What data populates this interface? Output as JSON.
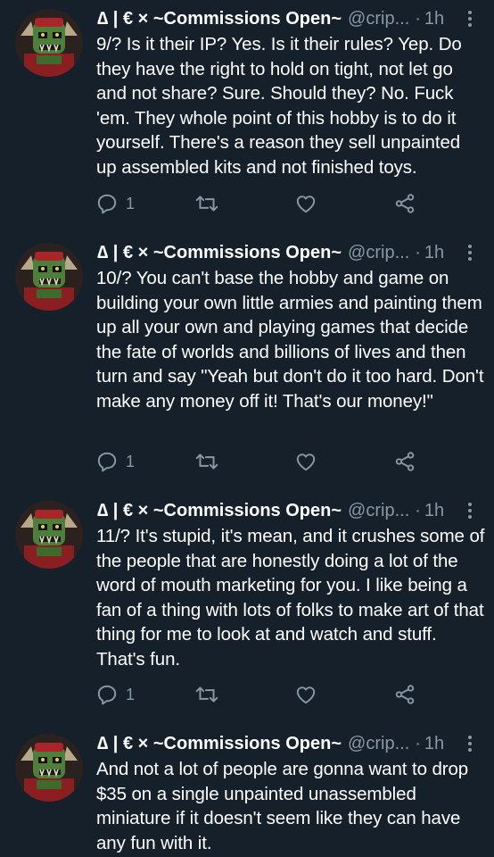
{
  "tweets": [
    {
      "display_name": "∆ | € × ~Commissions Open~",
      "handle": "@crip...",
      "separator": "·",
      "time": "1h",
      "text": "9/? Is it their IP? Yes. Is it their rules? Yep. Do they have the right to hold on tight, not let go and not share? Sure. Should they? No. Fuck 'em. They whole point of this hobby is to do it yourself. There's a reason they sell unpainted up assembled kits and not finished toys.",
      "reply_count": "1"
    },
    {
      "display_name": "∆ | € × ~Commissions Open~",
      "handle": "@crip...",
      "separator": "·",
      "time": "1h",
      "text": "10/? You can't base the hobby and game on building your own little armies and painting them up all your own and playing games that decide the fate of worlds and billions of lives and then turn and say \"Yeah but don't do it too hard. Don't make any money off it! That's our money!\"",
      "reply_count": "1"
    },
    {
      "display_name": "∆ | € × ~Commissions Open~",
      "handle": "@crip...",
      "separator": "·",
      "time": "1h",
      "text": "11/? It's stupid, it's mean, and it crushes some of the people that are honestly doing a lot of the word of mouth marketing for you. I like being a fan of a thing with lots of folks to make art of that thing for me to look at and watch and stuff. That's fun.",
      "reply_count": "1"
    },
    {
      "display_name": "∆ | € × ~Commissions Open~",
      "handle": "@crip...",
      "separator": "·",
      "time": "1h",
      "text": "And not a lot of people are gonna want to drop $35 on a single unpainted unassembled miniature if it doesn't seem like they can have any fun with it."
    }
  ],
  "icons": {
    "reply": "reply-icon",
    "retweet": "retweet-icon",
    "like": "like-icon",
    "share": "share-icon",
    "more": "more-options-icon"
  },
  "colors": {
    "background": "#15202b",
    "text": "#ffffff",
    "secondary": "#8899a6"
  }
}
